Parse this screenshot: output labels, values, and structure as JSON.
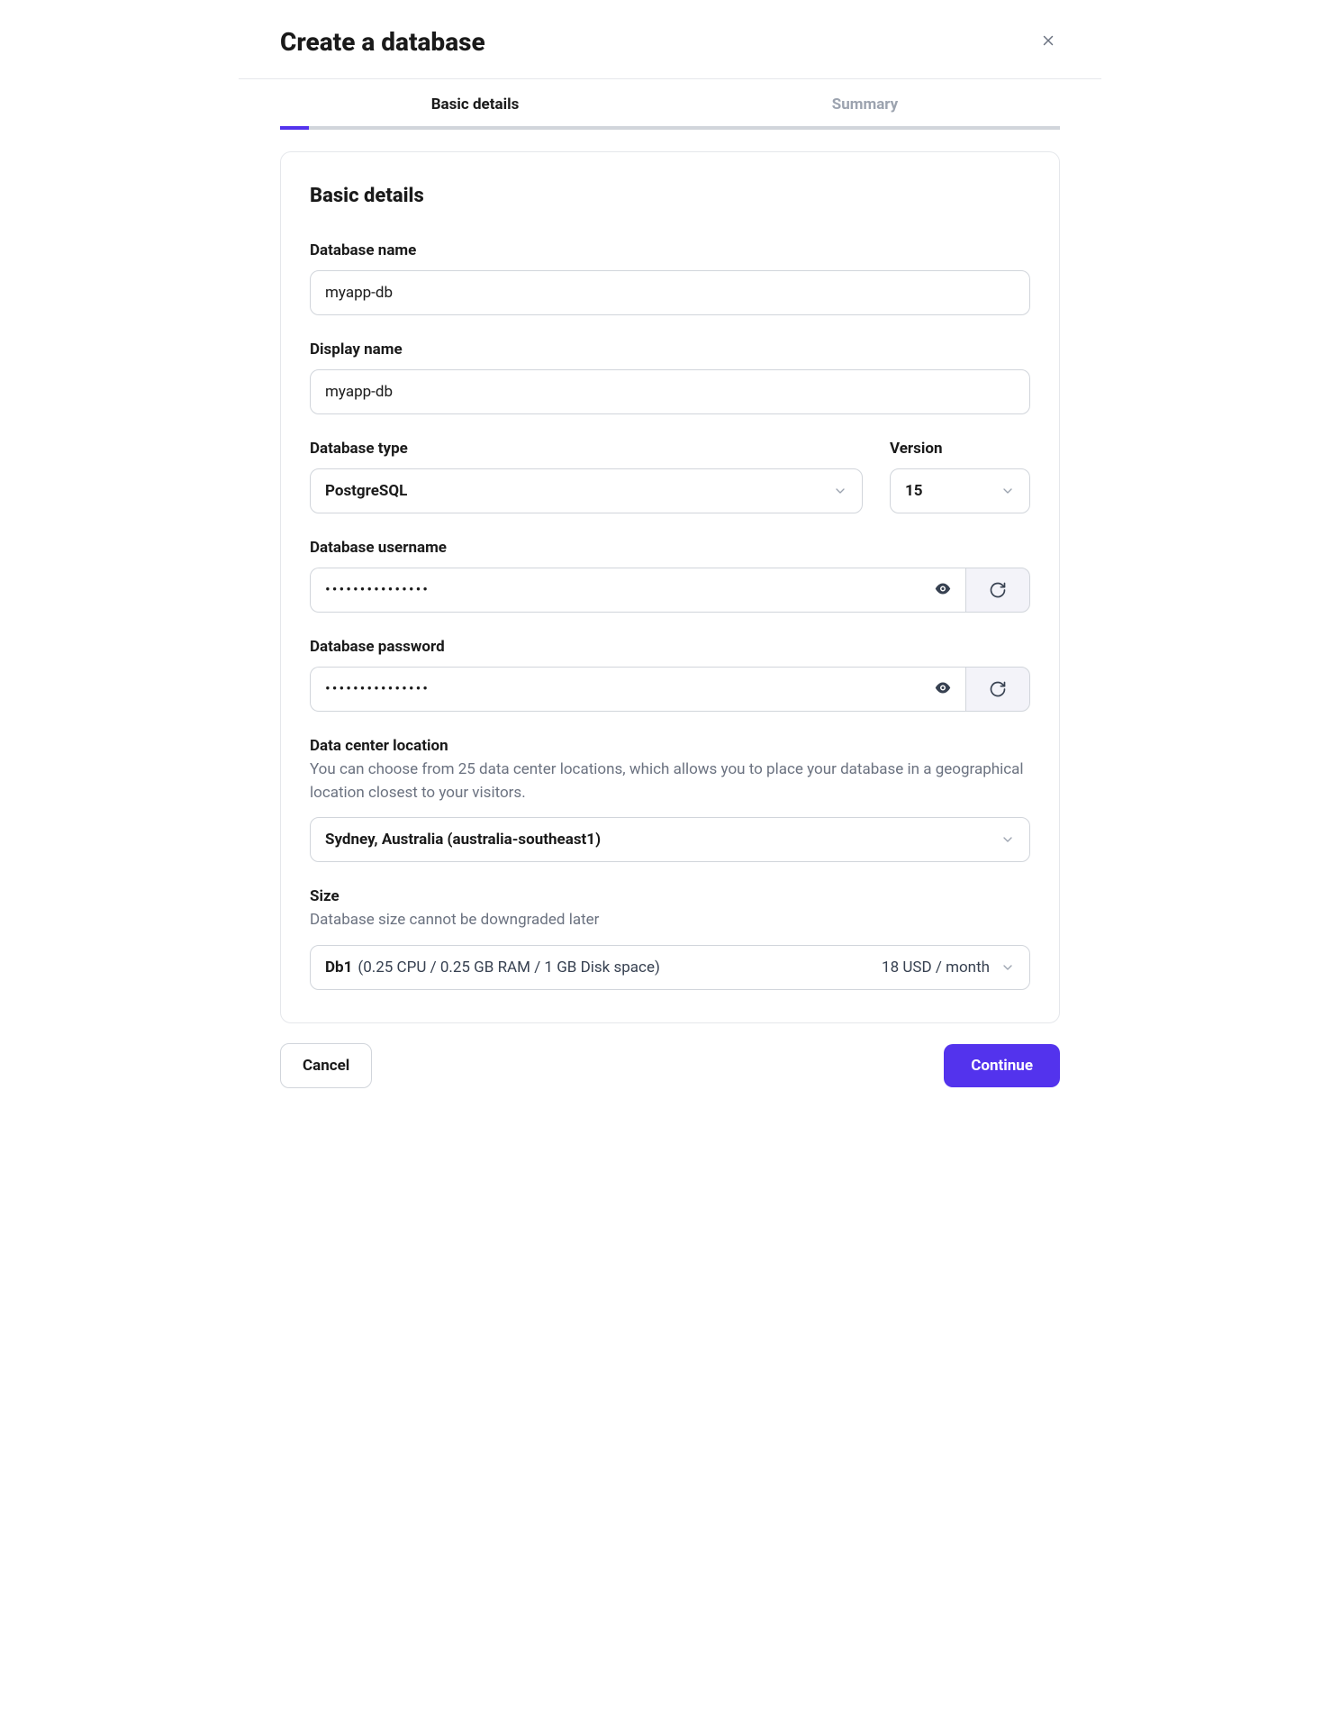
{
  "header": {
    "title": "Create a database"
  },
  "tabs": {
    "basic": "Basic details",
    "summary": "Summary"
  },
  "section": {
    "title": "Basic details"
  },
  "fields": {
    "db_name": {
      "label": "Database name",
      "value": "myapp-db"
    },
    "display_name": {
      "label": "Display name",
      "value": "myapp-db"
    },
    "db_type": {
      "label": "Database type",
      "value": "PostgreSQL"
    },
    "version": {
      "label": "Version",
      "value": "15"
    },
    "username": {
      "label": "Database username",
      "masked": "•••••••••••••••"
    },
    "password": {
      "label": "Database password",
      "masked": "•••••••••••••••"
    },
    "location": {
      "label": "Data center location",
      "help": "You can choose from 25 data center locations, which allows you to place your database in a geographical location closest to your visitors.",
      "value": "Sydney, Australia (australia-southeast1)"
    },
    "size": {
      "label": "Size",
      "help": "Database size cannot be downgraded later",
      "name": "Db1",
      "spec": "(0.25 CPU / 0.25 GB RAM / 1 GB Disk space)",
      "price": "18 USD / month"
    }
  },
  "footer": {
    "cancel": "Cancel",
    "continue": "Continue"
  }
}
